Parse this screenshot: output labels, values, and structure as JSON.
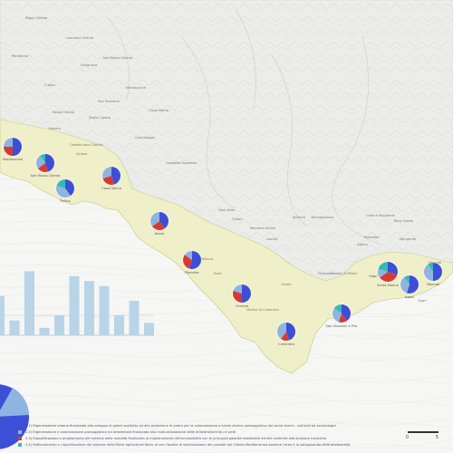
{
  "colors": {
    "blue": "#3c4fd6",
    "red": "#d63a36",
    "lightblue": "#8fb4e0",
    "teal": "#35b9b5",
    "bar": "#b9d4e6",
    "area": "#f0f1c4",
    "area_stroke": "#c9cc7e",
    "sea": "#f7f7f6",
    "land": "#e9e9e7"
  },
  "towns": [
    {
      "name": "Montecorice",
      "pie": [
        0.5,
        0.25,
        0.25,
        0
      ]
    },
    {
      "name": "San Mauro Cilento",
      "pie": [
        0.45,
        0.2,
        0.25,
        0.1
      ]
    },
    {
      "name": "Pollica",
      "pie": [
        0.4,
        0,
        0.4,
        0.2
      ]
    },
    {
      "name": "Casal Velino",
      "pie": [
        0.45,
        0.25,
        0.3,
        0
      ]
    },
    {
      "name": "Ascea",
      "pie": [
        0.4,
        0.25,
        0.35,
        0
      ]
    },
    {
      "name": "Pisciotta",
      "pie": [
        0.55,
        0.3,
        0.15,
        0
      ]
    },
    {
      "name": "Centola",
      "pie": [
        0.5,
        0.3,
        0.2,
        0
      ]
    },
    {
      "name": "Camerota",
      "pie": [
        0.45,
        0.15,
        0.4,
        0
      ]
    },
    {
      "name": "San Giovanni a Piro",
      "pie": [
        0.4,
        0.15,
        0.3,
        0.15
      ]
    },
    {
      "name": "Santa Marina",
      "pie": [
        0.3,
        0.35,
        0.15,
        0.2
      ]
    },
    {
      "name": "Ispani",
      "pie": [
        0.55,
        0,
        0.35,
        0.1
      ]
    },
    {
      "name": "Vibonati",
      "pie": [
        0.5,
        0,
        0.4,
        0.1
      ]
    },
    {
      "name": "Sapri",
      "pie": [
        0.45,
        0.15,
        0.4,
        0
      ]
    }
  ],
  "place_names": [
    "Pioppi Cilento",
    "Perdifumo",
    "Laureana Cilento",
    "Lustra",
    "Omignano",
    "Sessa Cilento",
    "Stella Cilento",
    "Montecorice",
    "San Mauro Cilento",
    "Casal Velino",
    "Salento",
    "Castelnuovo Cilento",
    "Ceraso",
    "Cannalonga",
    "Novi Velia",
    "Futani",
    "Montano Antilia",
    "Laurito",
    "Rofrano",
    "Roccagloriosa",
    "Alfano",
    "Celle di Bulgheria",
    "Torre Orsaia",
    "Morigerati",
    "Tortorella",
    "Vibonati",
    "Sapri",
    "Caselle in Pittari",
    "Policastro",
    "Scario",
    "Marina di Camerota",
    "Palinuro",
    "Foria",
    "San Severino",
    "Casaletto Spartano"
  ],
  "chart_data": {
    "type": "bar",
    "values": [
      8,
      3,
      13,
      1.5,
      4,
      12,
      11,
      10,
      4,
      7,
      2.5
    ],
    "ylim": [
      0,
      14
    ]
  },
  "legend": [
    {
      "color": "#3c4fd6",
      "text": "2.1) Rigenerazione urbana finalizzata allo sviluppo di poteri anzitutto ed alla protezione di poteri per la valorizzazione e tutela storico paesaggistica dei centri storici - culturali ed archeologici"
    },
    {
      "color": "#8fb4e0",
      "text": "2.2) Rigenerazione e valorizzazione paesaggistica ed ambientale finalizzata alla rinaturalizzazione delle infrastrutture blu e verdi"
    },
    {
      "color": "#d63a36",
      "text": "2.3) Riqualificazione e ampliamento del sistema della mobilità finalizzata al miglioramento dell'accessibilità con le principali polarità insediative ed alle conferite alle strutture turistiche"
    },
    {
      "color": "#35b9b5",
      "text": "2.4) Rafforzamento e riqualificazione del sistema della filiera agricola ed ittica, al con l'ausilio di valorizzazione dei prodotti del Cilento Mediterraneo assieme l'area e la salvaguardia delle biodiversità"
    }
  ],
  "scale": {
    "start": "0",
    "end": "5"
  }
}
